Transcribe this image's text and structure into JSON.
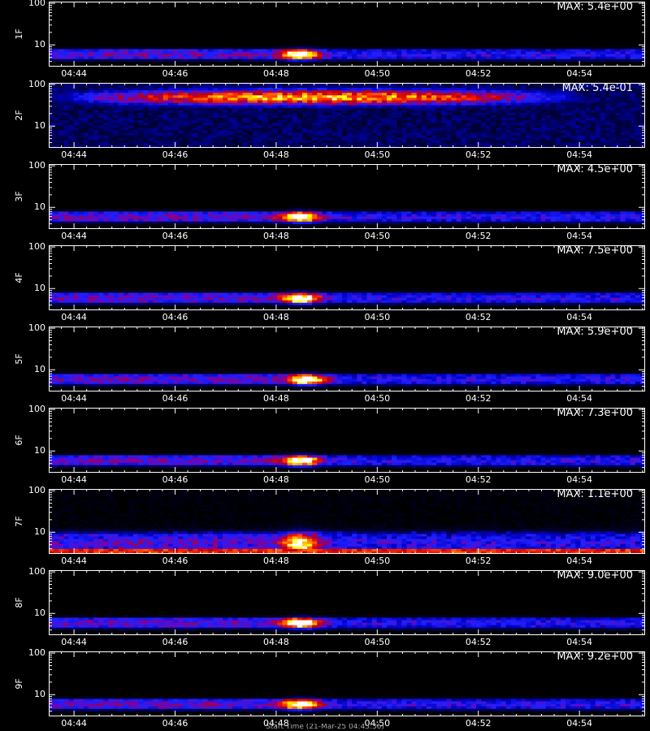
{
  "chart_data": {
    "type": "heatmap",
    "x_tick_labels": [
      "04:44",
      "04:46",
      "04:48",
      "04:50",
      "04:52",
      "04:54"
    ],
    "x_tick_minutes": [
      44,
      46,
      48,
      50,
      52,
      54
    ],
    "xlim_minutes": [
      43.5,
      55.3
    ],
    "y_tick_labels": [
      "100",
      "10"
    ],
    "y_scale": "log",
    "ylim": [
      3,
      110
    ],
    "colormap": [
      "#000000",
      "#000050",
      "#0000c8",
      "#2020ff",
      "#8000a0",
      "#c00000",
      "#ff2000",
      "#ff8000",
      "#ffff00",
      "#ffffff"
    ],
    "panels": [
      {
        "label": "1F",
        "max_label": "MAX: 5.4e+00",
        "max": 5.4,
        "band": [
          4.5,
          7.5
        ],
        "peak_minutes": 48.5,
        "peak_energy": 6.0
      },
      {
        "label": "2F",
        "max_label": "MAX: 5.4e-01",
        "max": 0.54,
        "band": [
          30,
          80
        ],
        "peak_minutes": 48.8,
        "peak_energy": 50
      },
      {
        "label": "3F",
        "max_label": "MAX: 4.5e+00",
        "max": 4.5,
        "band": [
          4.5,
          7.5
        ],
        "peak_minutes": 48.5,
        "peak_energy": 6.0
      },
      {
        "label": "4F",
        "max_label": "MAX: 7.5e+00",
        "max": 7.5,
        "band": [
          4.5,
          7.5
        ],
        "peak_minutes": 48.5,
        "peak_energy": 6.5
      },
      {
        "label": "5F",
        "max_label": "MAX: 5.9e+00",
        "max": 5.9,
        "band": [
          4.5,
          7.5
        ],
        "peak_minutes": 48.6,
        "peak_energy": 6.5
      },
      {
        "label": "6F",
        "max_label": "MAX: 7.3e+00",
        "max": 7.3,
        "band": [
          4.5,
          7.5
        ],
        "peak_minutes": 48.5,
        "peak_energy": 6.0
      },
      {
        "label": "7F",
        "max_label": "MAX: 1.1e+00",
        "max": 1.1,
        "band": [
          3.2,
          9.0
        ],
        "peak_minutes": 48.5,
        "peak_energy": 8.5
      },
      {
        "label": "8F",
        "max_label": "MAX: 9.0e+00",
        "max": 9.0,
        "band": [
          4.5,
          7.5
        ],
        "peak_minutes": 48.5,
        "peak_energy": 6.5
      },
      {
        "label": "9F",
        "max_label": "MAX: 9.2e+00",
        "max": 9.2,
        "band": [
          4.5,
          7.5
        ],
        "peak_minutes": 48.5,
        "peak_energy": 6.0
      }
    ],
    "xlabel": "Start Time (21-Mar-25 04:43:36)"
  }
}
